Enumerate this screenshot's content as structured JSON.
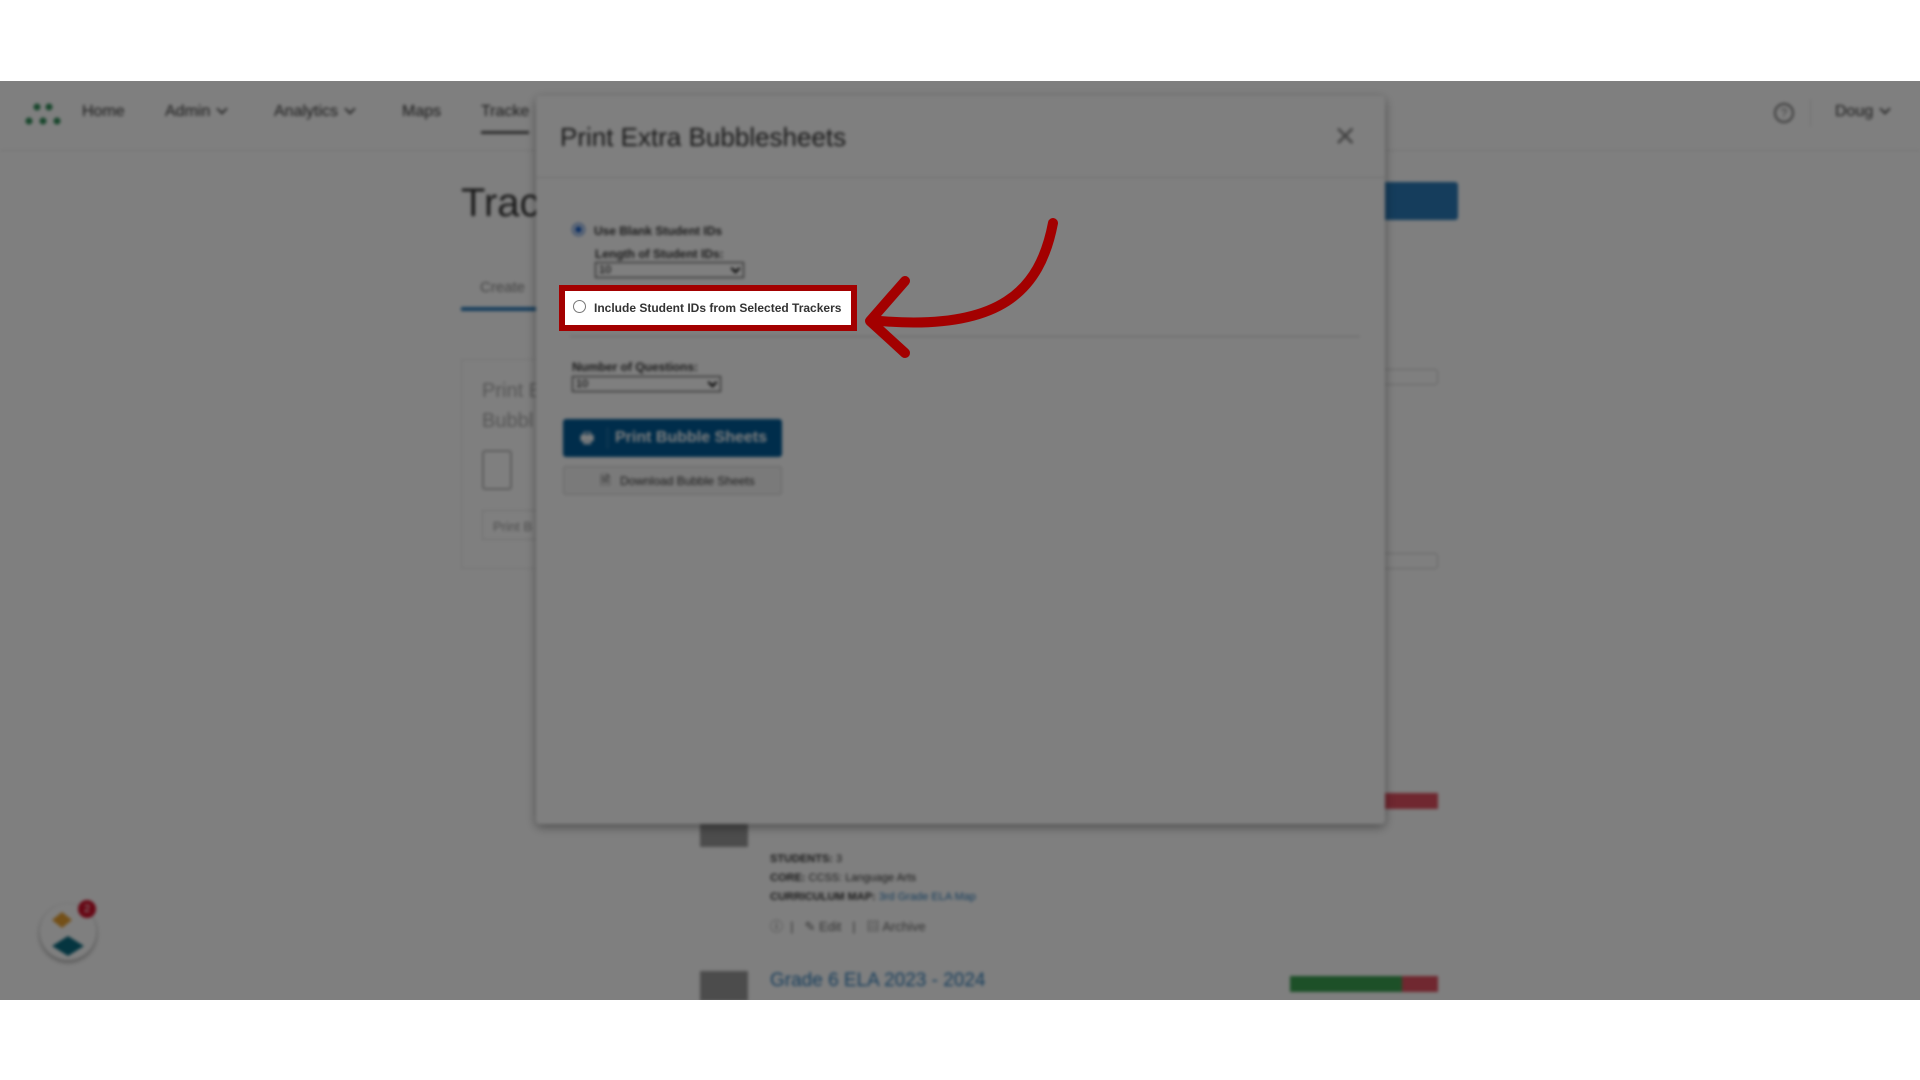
{
  "nav": {
    "items": [
      {
        "label": "Home"
      },
      {
        "label": "Admin",
        "has_dropdown": true
      },
      {
        "label": "Analytics",
        "has_dropdown": true
      },
      {
        "label": "Maps"
      },
      {
        "label": "Tracke",
        "active": true
      }
    ],
    "user": "Doug",
    "help_icon": "question-circle-icon"
  },
  "page": {
    "title_fragment": "Trac",
    "tab_fragment": "Create",
    "card": {
      "line1": "Print E",
      "line2": "Bubbl",
      "button": "Print B"
    },
    "tracker": {
      "students_label": "STUDENTS:",
      "students_value": "3",
      "core_label": "CORE:",
      "core_value": "CCSS: Language Arts",
      "map_label": "CURRICULUM MAP:",
      "map_value": "3rd Grade ELA Map",
      "edit": "Edit",
      "archive": "Archive"
    },
    "next_tracker": "Grade 6 ELA 2023 - 2024"
  },
  "widget": {
    "badge": "2"
  },
  "modal": {
    "title": "Print Extra Bubblesheets",
    "option_blank": "Use Blank Student IDs",
    "length_label": "Length of Student IDs:",
    "length_value": "10",
    "option_include": "Include Student IDs from Selected Trackers",
    "questions_label": "Number of Questions:",
    "questions_value": "10",
    "print_button": "Print Bubble Sheets",
    "download_button": "Download Bubble Sheets",
    "selected_option": "Use Blank Student IDs"
  },
  "colors": {
    "primary": "#005a96",
    "annotation": "#a30000"
  }
}
